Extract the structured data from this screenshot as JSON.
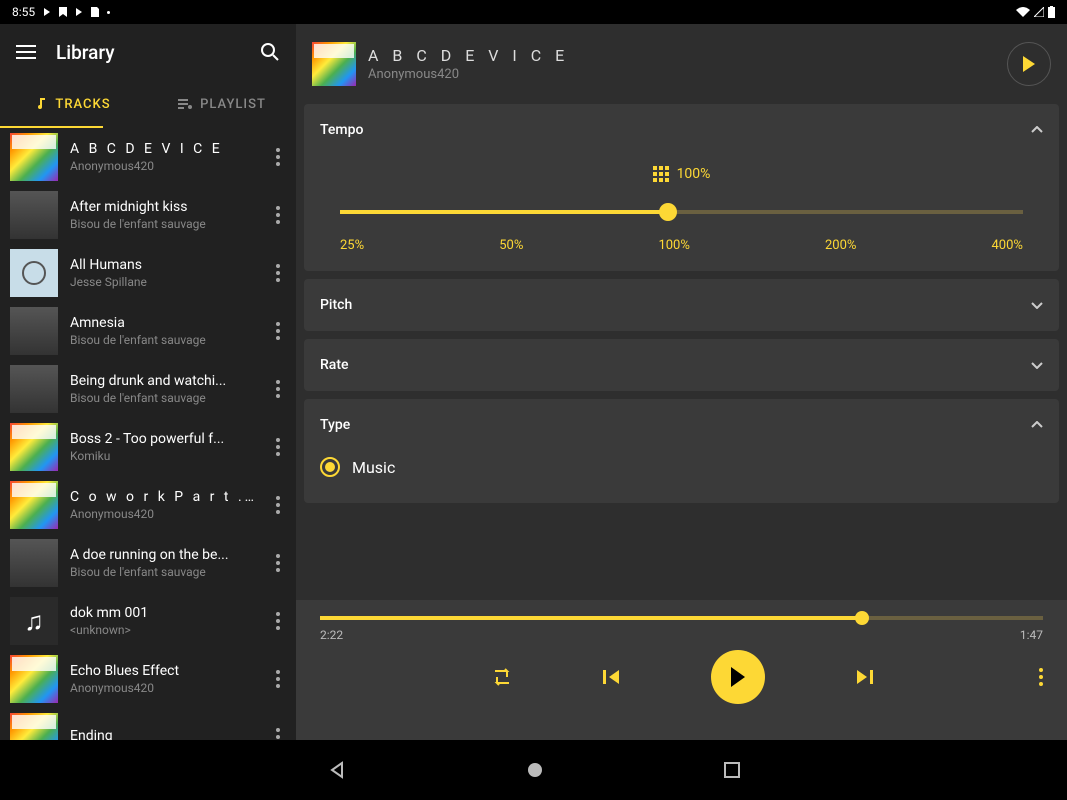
{
  "status": {
    "time": "8:55"
  },
  "sidebar": {
    "title": "Library",
    "tabs": {
      "tracks": "TRACKS",
      "playlists": "PLAYLIST"
    }
  },
  "tracks": [
    {
      "title": "A B C D E V I C E",
      "artist": "Anonymous420",
      "art": "color",
      "spaced": true
    },
    {
      "title": "After midnight kiss",
      "artist": "Bisou de l'enfant sauvage",
      "art": "grey"
    },
    {
      "title": "All Humans",
      "artist": "Jesse Spillane",
      "art": "humans"
    },
    {
      "title": "Amnesia",
      "artist": "Bisou de l'enfant sauvage",
      "art": "grey"
    },
    {
      "title": "Being drunk and watchi...",
      "artist": "Bisou de l'enfant sauvage",
      "art": "grey"
    },
    {
      "title": "Boss 2 - Too powerful f...",
      "artist": "Komiku",
      "art": "color"
    },
    {
      "title": "C o w o r k P a r t ...",
      "artist": "Anonymous420",
      "art": "color",
      "spaced": true
    },
    {
      "title": "A doe running on the be...",
      "artist": "Bisou de l'enfant sauvage",
      "art": "grey"
    },
    {
      "title": "dok mm 001",
      "artist": "<unknown>",
      "art": "note"
    },
    {
      "title": "Echo Blues Effect",
      "artist": "Anonymous420",
      "art": "color"
    },
    {
      "title": "Ending",
      "artist": "",
      "art": "color"
    }
  ],
  "now_playing": {
    "title": "A B C D E V I C E",
    "artist": "Anonymous420"
  },
  "panels": {
    "tempo": {
      "label": "Tempo",
      "value": "100%",
      "ticks": [
        "25%",
        "50%",
        "100%",
        "200%",
        "400%"
      ],
      "fill_pct": 48
    },
    "pitch": {
      "label": "Pitch"
    },
    "rate": {
      "label": "Rate"
    },
    "type": {
      "label": "Type",
      "option1": "Music"
    }
  },
  "player": {
    "elapsed": "2:22",
    "remaining": "1:47",
    "progress_pct": 75
  }
}
